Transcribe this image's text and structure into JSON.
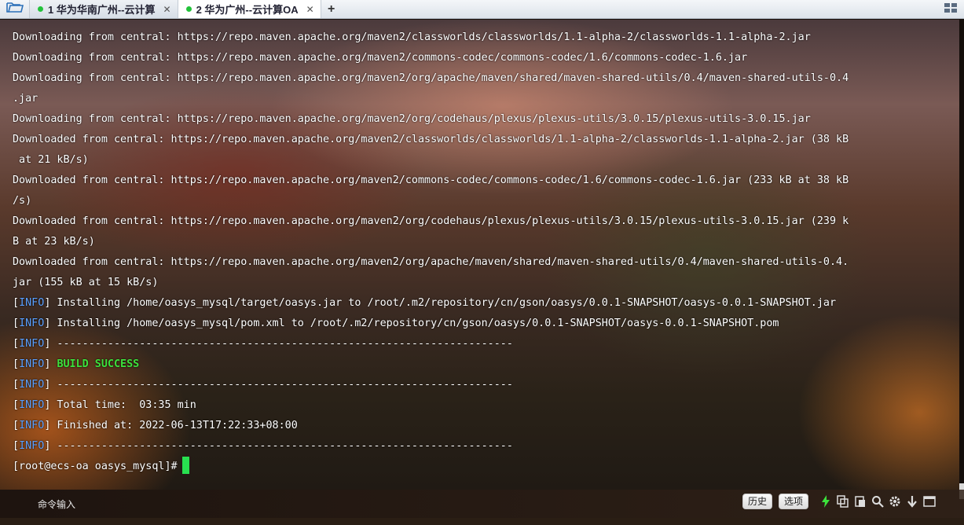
{
  "tabs": [
    {
      "label": "1 华为华南广州--云计算",
      "active": false
    },
    {
      "label": "2 华为广州--云计算OA",
      "active": true
    }
  ],
  "terminal": {
    "lines": [
      {
        "text": "Downloading from central: https://repo.maven.apache.org/maven2/classworlds/classworlds/1.1-alpha-2/classworlds-1.1-alpha-2.jar"
      },
      {
        "text": "Downloading from central: https://repo.maven.apache.org/maven2/commons-codec/commons-codec/1.6/commons-codec-1.6.jar"
      },
      {
        "text": "Downloading from central: https://repo.maven.apache.org/maven2/org/apache/maven/shared/maven-shared-utils/0.4/maven-shared-utils-0.4"
      },
      {
        "text": ".jar"
      },
      {
        "text": "Downloading from central: https://repo.maven.apache.org/maven2/org/codehaus/plexus/plexus-utils/3.0.15/plexus-utils-3.0.15.jar"
      },
      {
        "text": "Downloaded from central: https://repo.maven.apache.org/maven2/classworlds/classworlds/1.1-alpha-2/classworlds-1.1-alpha-2.jar (38 kB"
      },
      {
        "text": " at 21 kB/s)"
      },
      {
        "text": "Downloaded from central: https://repo.maven.apache.org/maven2/commons-codec/commons-codec/1.6/commons-codec-1.6.jar (233 kB at 38 kB"
      },
      {
        "text": "/s)"
      },
      {
        "text": "Downloaded from central: https://repo.maven.apache.org/maven2/org/codehaus/plexus/plexus-utils/3.0.15/plexus-utils-3.0.15.jar (239 k"
      },
      {
        "text": "B at 23 kB/s)"
      },
      {
        "text": "Downloaded from central: https://repo.maven.apache.org/maven2/org/apache/maven/shared/maven-shared-utils/0.4/maven-shared-utils-0.4."
      },
      {
        "text": "jar (155 kB at 15 kB/s)"
      },
      {
        "tag": "INFO",
        "text": " Installing /home/oasys_mysql/target/oasys.jar to /root/.m2/repository/cn/gson/oasys/0.0.1-SNAPSHOT/oasys-0.0.1-SNAPSHOT.jar"
      },
      {
        "tag": "INFO",
        "text": " Installing /home/oasys_mysql/pom.xml to /root/.m2/repository/cn/gson/oasys/0.0.1-SNAPSHOT/oasys-0.0.1-SNAPSHOT.pom"
      },
      {
        "tag": "INFO",
        "text": " ------------------------------------------------------------------------"
      },
      {
        "tag": "INFO",
        "text": " ",
        "success": "BUILD SUCCESS"
      },
      {
        "tag": "INFO",
        "text": " ------------------------------------------------------------------------"
      },
      {
        "tag": "INFO",
        "text": " Total time:  03:35 min"
      },
      {
        "tag": "INFO",
        "text": " Finished at: 2022-06-13T17:22:33+08:00"
      },
      {
        "tag": "INFO",
        "text": " ------------------------------------------------------------------------"
      }
    ],
    "prompt": "[root@ecs-oa oasys_mysql]# "
  },
  "cmdbar": {
    "label": "命令输入",
    "history_btn": "历史",
    "options_btn": "选项",
    "icons": [
      "lightning-icon",
      "copy-icon",
      "paste-icon",
      "search-icon",
      "gear-icon",
      "download-arrow-icon",
      "window-icon"
    ]
  },
  "colors": {
    "info": "#5aa0ff",
    "success": "#3ce23c",
    "cursor": "#28e050"
  }
}
